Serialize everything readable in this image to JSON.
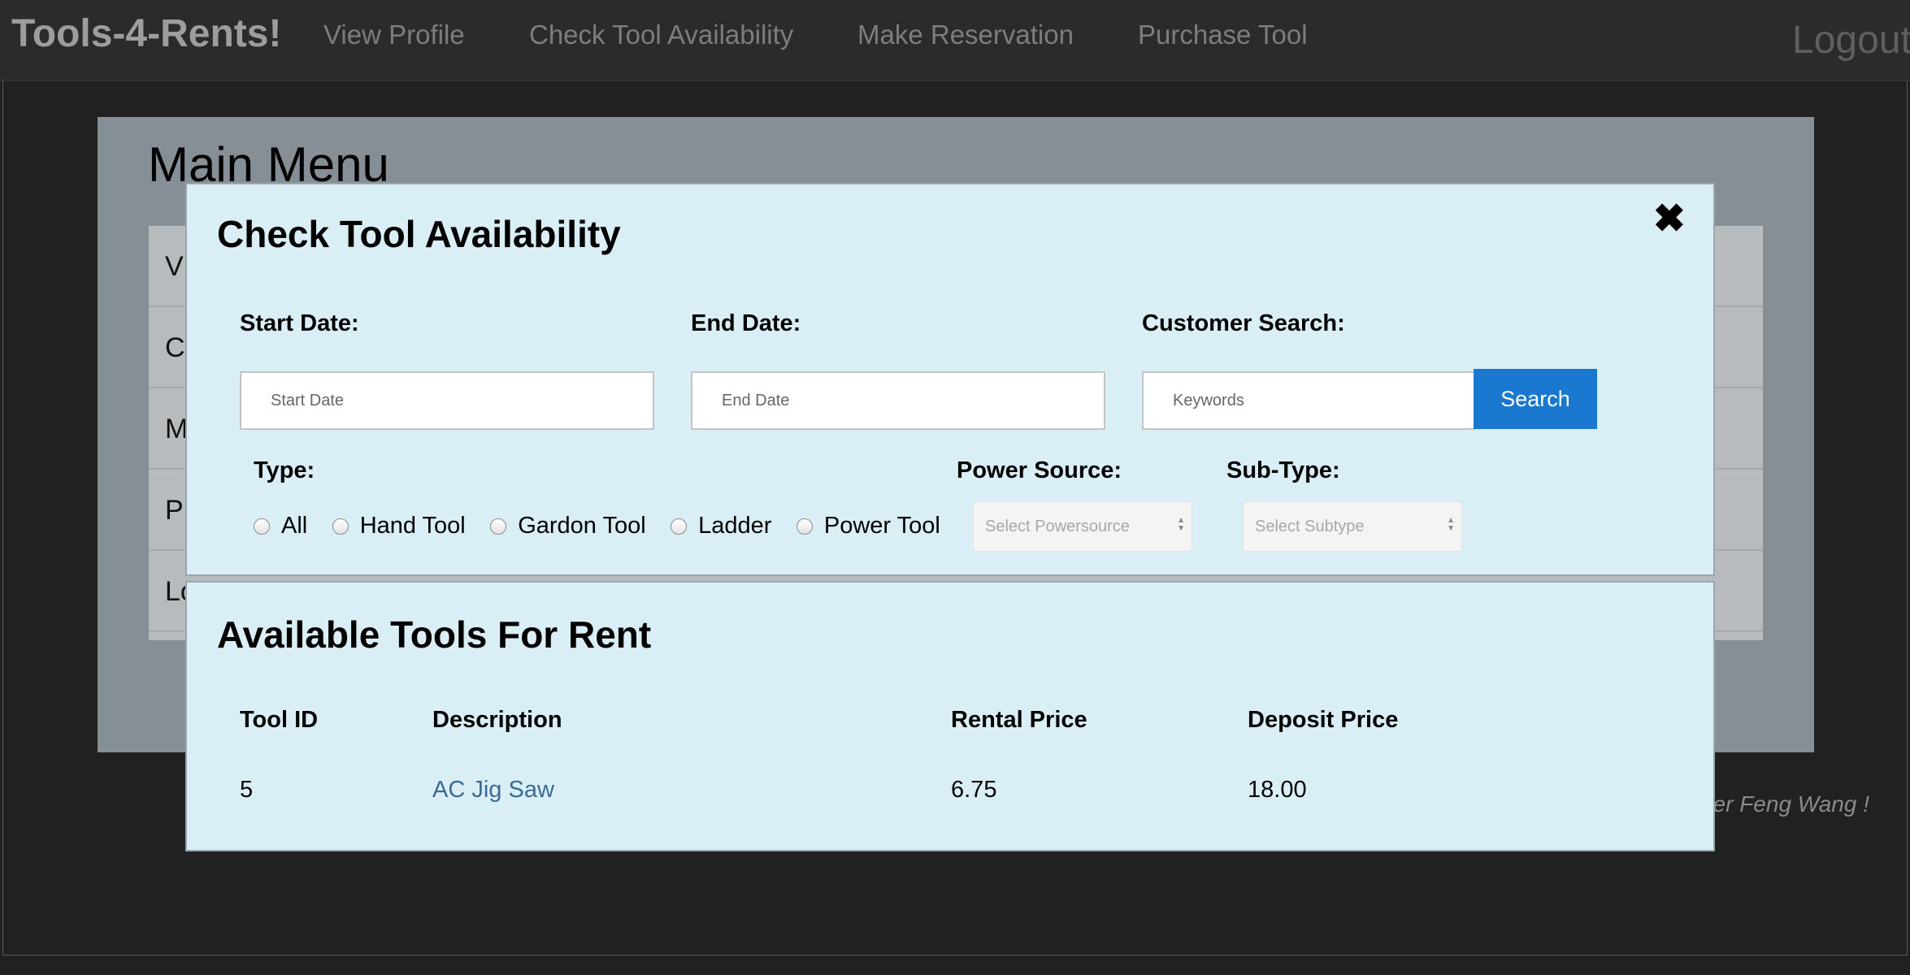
{
  "navbar": {
    "brand": "Tools-4-Rents!",
    "links": [
      "View Profile",
      "Check Tool Availability",
      "Make Reservation",
      "Purchase Tool"
    ],
    "logout": "Logout"
  },
  "main": {
    "title": "Main Menu",
    "menu_items": [
      "V",
      "C",
      "M",
      "P",
      "Lo"
    ],
    "footer_note": "er Feng Wang !"
  },
  "availability_modal": {
    "title": "Check Tool Availability",
    "start_date": {
      "label": "Start Date:",
      "placeholder": "Start Date"
    },
    "end_date": {
      "label": "End Date:",
      "placeholder": "End Date"
    },
    "customer_search": {
      "label": "Customer Search:",
      "placeholder": "Keywords",
      "button": "Search"
    },
    "type": {
      "label": "Type:",
      "options": [
        "All",
        "Hand Tool",
        "Gardon Tool",
        "Ladder",
        "Power Tool"
      ]
    },
    "power_source": {
      "label": "Power Source:",
      "placeholder": "Select Powersource"
    },
    "sub_type": {
      "label": "Sub-Type:",
      "placeholder": "Select Subtype"
    },
    "close_icon": "close-icon"
  },
  "results": {
    "title": "Available Tools For Rent",
    "columns": [
      "Tool ID",
      "Description",
      "Rental Price",
      "Deposit Price"
    ],
    "rows": [
      {
        "tool_id": "5",
        "description": "AC Jig Saw",
        "rental_price": "6.75",
        "deposit_price": "18.00"
      }
    ]
  },
  "colors": {
    "navbar_bg": "#2b2b2b",
    "modal_bg": "#daeef5",
    "search_button": "#1a78d0",
    "link": "#3a6a96"
  }
}
